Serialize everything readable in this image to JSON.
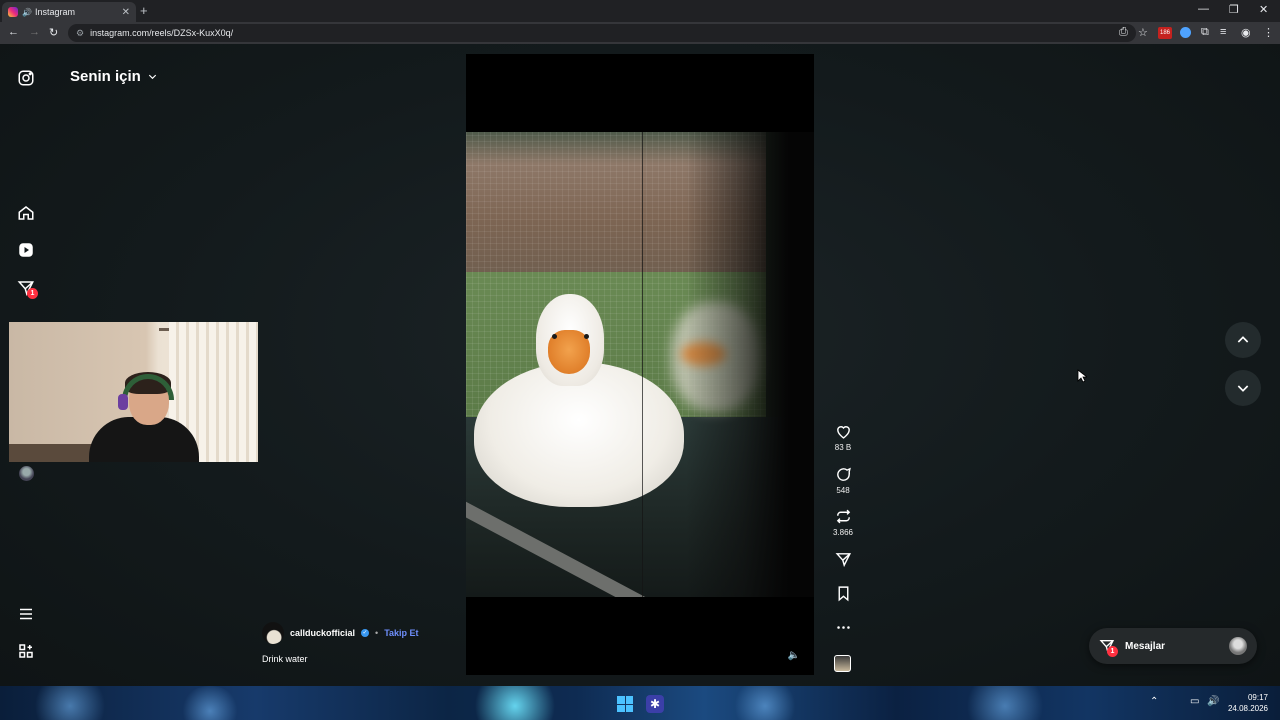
{
  "browser": {
    "tab_title": "Instagram",
    "new_tab": "+",
    "tab_close": "✕",
    "url": "instagram.com/reels/DZSx-KuxX0q/",
    "extension_badge": "186",
    "window_controls": [
      "—",
      "❐",
      "✕"
    ]
  },
  "sidebar": {
    "feed_title": "Senin için",
    "notification_count": "1"
  },
  "reel": {
    "author": "callduckofficial",
    "follow_label": "Takip Et",
    "separator": "•",
    "caption": "Drink water",
    "likes": "83 B",
    "comments": "548",
    "reposts": "3.866"
  },
  "messages": {
    "label": "Mesajlar",
    "badge": "1"
  },
  "taskbar": {
    "time": "09:17",
    "date": "24.08.2026"
  },
  "colors": {
    "accent_link": "#6e8efb",
    "notification": "#ff3040",
    "verified": "#3897f0"
  }
}
